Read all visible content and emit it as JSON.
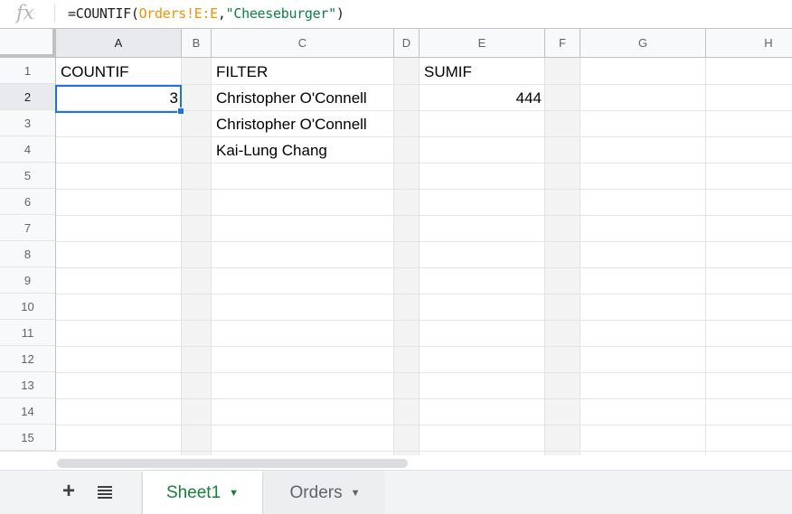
{
  "formula_bar": {
    "icon": "fx",
    "formula_prefix": "=COUNTIF(",
    "formula_range": "Orders!E:E",
    "formula_sep": ",",
    "formula_string": "\"Cheeseburger\"",
    "formula_suffix": ")"
  },
  "columns": [
    "A",
    "B",
    "C",
    "D",
    "E",
    "F",
    "G",
    "H"
  ],
  "rows": [
    "1",
    "2",
    "3",
    "4",
    "5",
    "6",
    "7",
    "8",
    "9",
    "10",
    "11",
    "12",
    "13",
    "14",
    "15"
  ],
  "cells": {
    "A1": "COUNTIF",
    "A2": "3",
    "C1": "FILTER",
    "C2": "Christopher O'Connell",
    "C3": "Christopher O'Connell",
    "C4": "Kai-Lung Chang",
    "E1": "SUMIF",
    "E2": "444"
  },
  "active_cell": "A2",
  "sheet_tabs": [
    {
      "label": "Sheet1",
      "active": true
    },
    {
      "label": "Orders",
      "active": false
    }
  ],
  "icons": {
    "add_sheet": "plus-icon",
    "all_sheets": "menu-list-icon",
    "tab_menu": "caret-down-icon"
  },
  "colors": {
    "selection": "#1a73e8",
    "active_tab_text": "#188038",
    "formula_range": "#f09300",
    "formula_string": "#0b8043"
  }
}
